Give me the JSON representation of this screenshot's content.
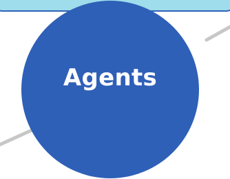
{
  "diagram": {
    "node": {
      "label": "Agents"
    },
    "colors": {
      "banner_fill": "#9fddec",
      "banner_border": "#2f63b8",
      "node_fill": "#2f60b7",
      "node_text": "#ffffff",
      "connector": "#c7c7c7"
    }
  }
}
